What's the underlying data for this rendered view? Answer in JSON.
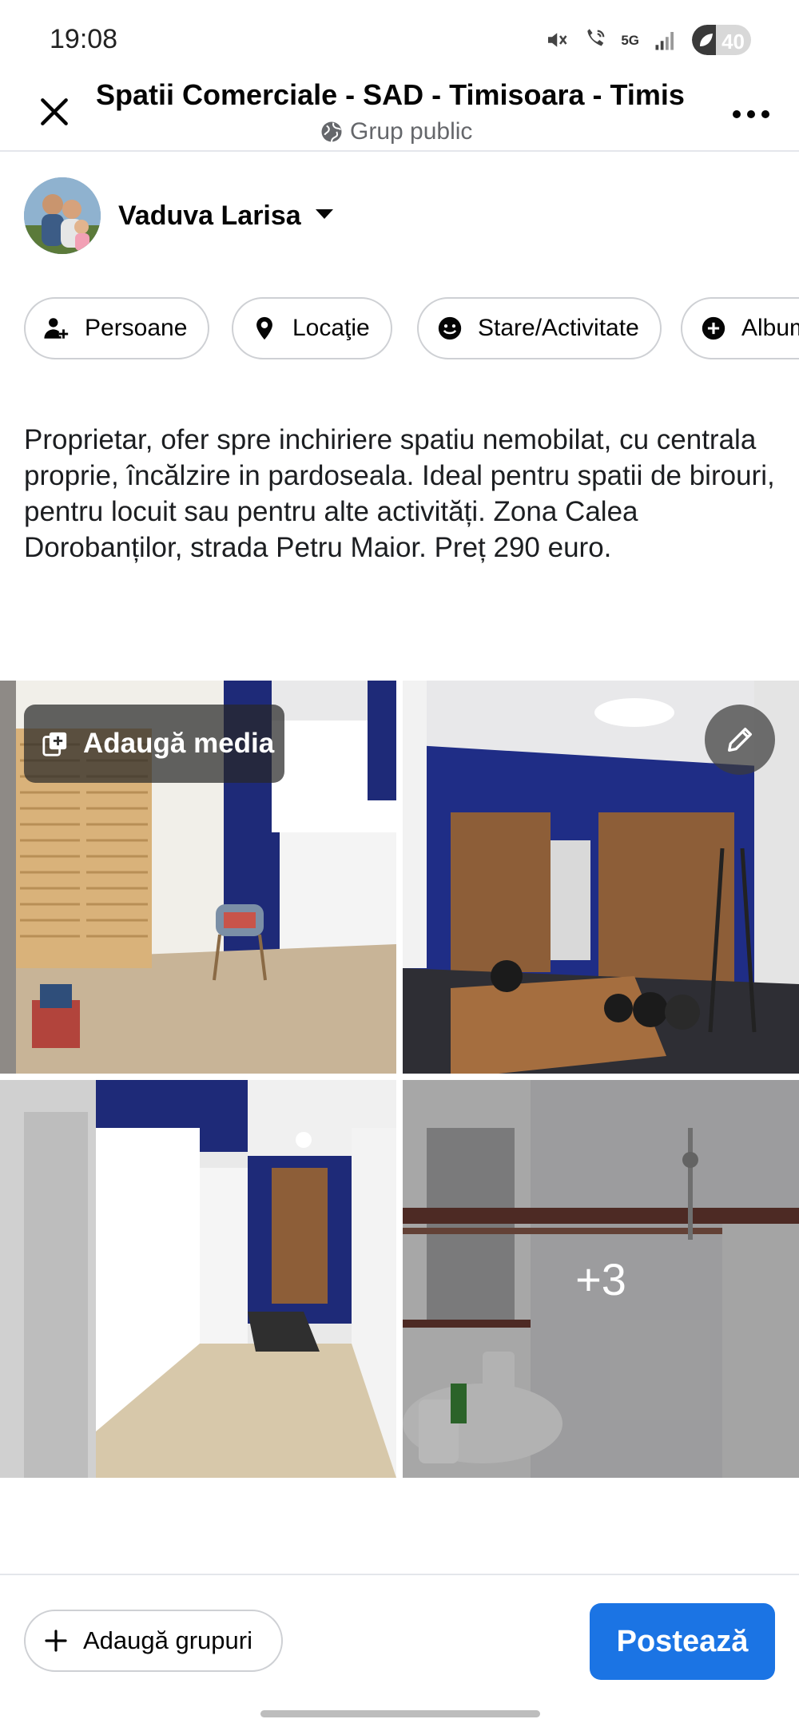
{
  "status_bar": {
    "time": "19:08",
    "network": "5G",
    "battery": "40",
    "battery_level": 0.4
  },
  "header": {
    "title": "Spatii Comerciale - SAD - Timisoara - Timis",
    "subtitle": "Grup public"
  },
  "author": {
    "name": "Vaduva Larisa"
  },
  "chips": [
    {
      "label": "Persoane",
      "icon": "person-add-icon"
    },
    {
      "label": "Locaţie",
      "icon": "location-pin-icon"
    },
    {
      "label": "Stare/Activitate",
      "icon": "smiley-icon"
    },
    {
      "label": "Album",
      "icon": "plus-circle-icon"
    }
  ],
  "post": {
    "text": "Proprietar, ofer spre inchiriere spatiu  nemobilat, cu centrala proprie, încălzire in pardoseala. Ideal pentru spatii de birouri, pentru locuit sau pentru alte activități. Zona Calea Dorobanților, strada Petru Maior. Preț 290 euro."
  },
  "media": {
    "add_media_label": "Adaugă media",
    "more_count": "+3"
  },
  "bottom": {
    "add_groups_label": "Adaugă grupuri",
    "post_label": "Postează"
  },
  "colors": {
    "accent": "#1b74e4",
    "text": "#050505",
    "secondary_text": "#65676b",
    "border": "#ced0d4"
  }
}
